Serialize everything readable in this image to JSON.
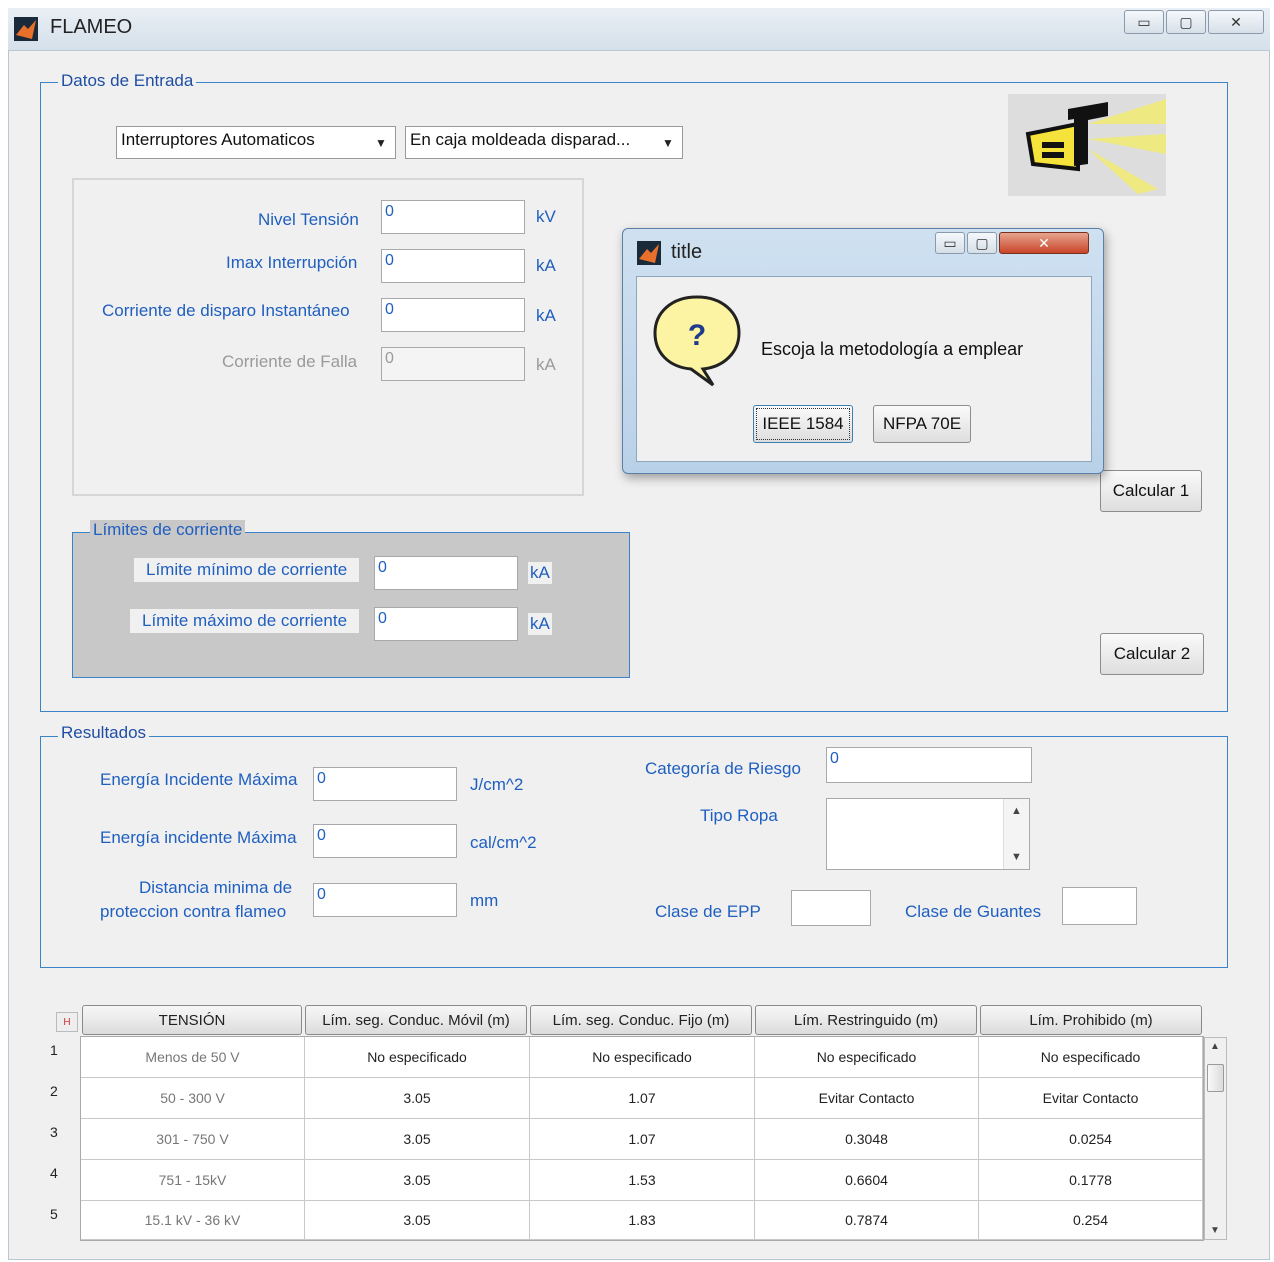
{
  "window": {
    "title": "FLAMEO",
    "controls": {
      "minimize": "▭",
      "maximize": "▢",
      "close": "✕"
    }
  },
  "entrada": {
    "group_title": "Datos de Entrada",
    "dropdown1": "Interruptores Automaticos",
    "dropdown2": "En caja moldeada disparad...",
    "fields": [
      {
        "label": "Nivel Tensión",
        "value": "0",
        "unit": "kV"
      },
      {
        "label": "Imax Interrupción",
        "value": "0",
        "unit": "kA"
      },
      {
        "label": "Corriente de disparo Instantáneo",
        "value": "0",
        "unit": "kA"
      },
      {
        "label": "Corriente de Falla",
        "value": "0",
        "unit": "kA"
      }
    ],
    "limits": {
      "title": "Límites de corriente",
      "min_label": "Límite mínimo de corriente",
      "min_value": "0",
      "min_unit": "kA",
      "max_label": "Límite máximo de corriente",
      "max_value": "0",
      "max_unit": "kA"
    },
    "calc1": "Calcular 1",
    "calc2": "Calcular 2",
    "logo_icon": "et-logo"
  },
  "dialog": {
    "title": "title",
    "message": "Escoja la metodología a emplear",
    "question_icon": "?",
    "btn1": "IEEE 1584",
    "btn2": "NFPA 70E"
  },
  "resultados": {
    "group_title": "Resultados",
    "energia1_label": "Energía Incidente Máxima",
    "energia1_value": "0",
    "energia1_unit": "J/cm^2",
    "energia2_label": "Energía incidente Máxima",
    "energia2_value": "0",
    "energia2_unit": "cal/cm^2",
    "distancia_label1": "Distancia minima de",
    "distancia_label2": "proteccion contra flameo",
    "distancia_value": "0",
    "distancia_unit": "mm",
    "categoria_label": "Categoría de Riesgo",
    "categoria_value": "0",
    "tipo_ropa_label": "Tipo Ropa",
    "clase_epp_label": "Clase de EPP",
    "clase_guantes_label": "Clase de Guantes"
  },
  "table": {
    "headers": [
      "TENSIÓN",
      "Lím. seg. Conduc. Móvil (m)",
      "Lím. seg. Conduc. Fijo (m)",
      "Lím. Restringuido (m)",
      "Lím. Prohibido (m)"
    ],
    "row_numbers": [
      "1",
      "2",
      "3",
      "4",
      "5"
    ],
    "rows": [
      [
        "Menos de 50 V",
        "No especificado",
        "No especificado",
        "No especificado",
        "No especificado"
      ],
      [
        "50 - 300 V",
        "3.05",
        "1.07",
        "Evitar Contacto",
        "Evitar Contacto"
      ],
      [
        "301 - 750 V",
        "3.05",
        "1.07",
        "0.3048",
        "0.0254"
      ],
      [
        "751 - 15kV",
        "3.05",
        "1.53",
        "0.6604",
        "0.1778"
      ],
      [
        "15.1 kV - 36 kV",
        "3.05",
        "1.83",
        "0.7874",
        "0.254"
      ]
    ]
  }
}
